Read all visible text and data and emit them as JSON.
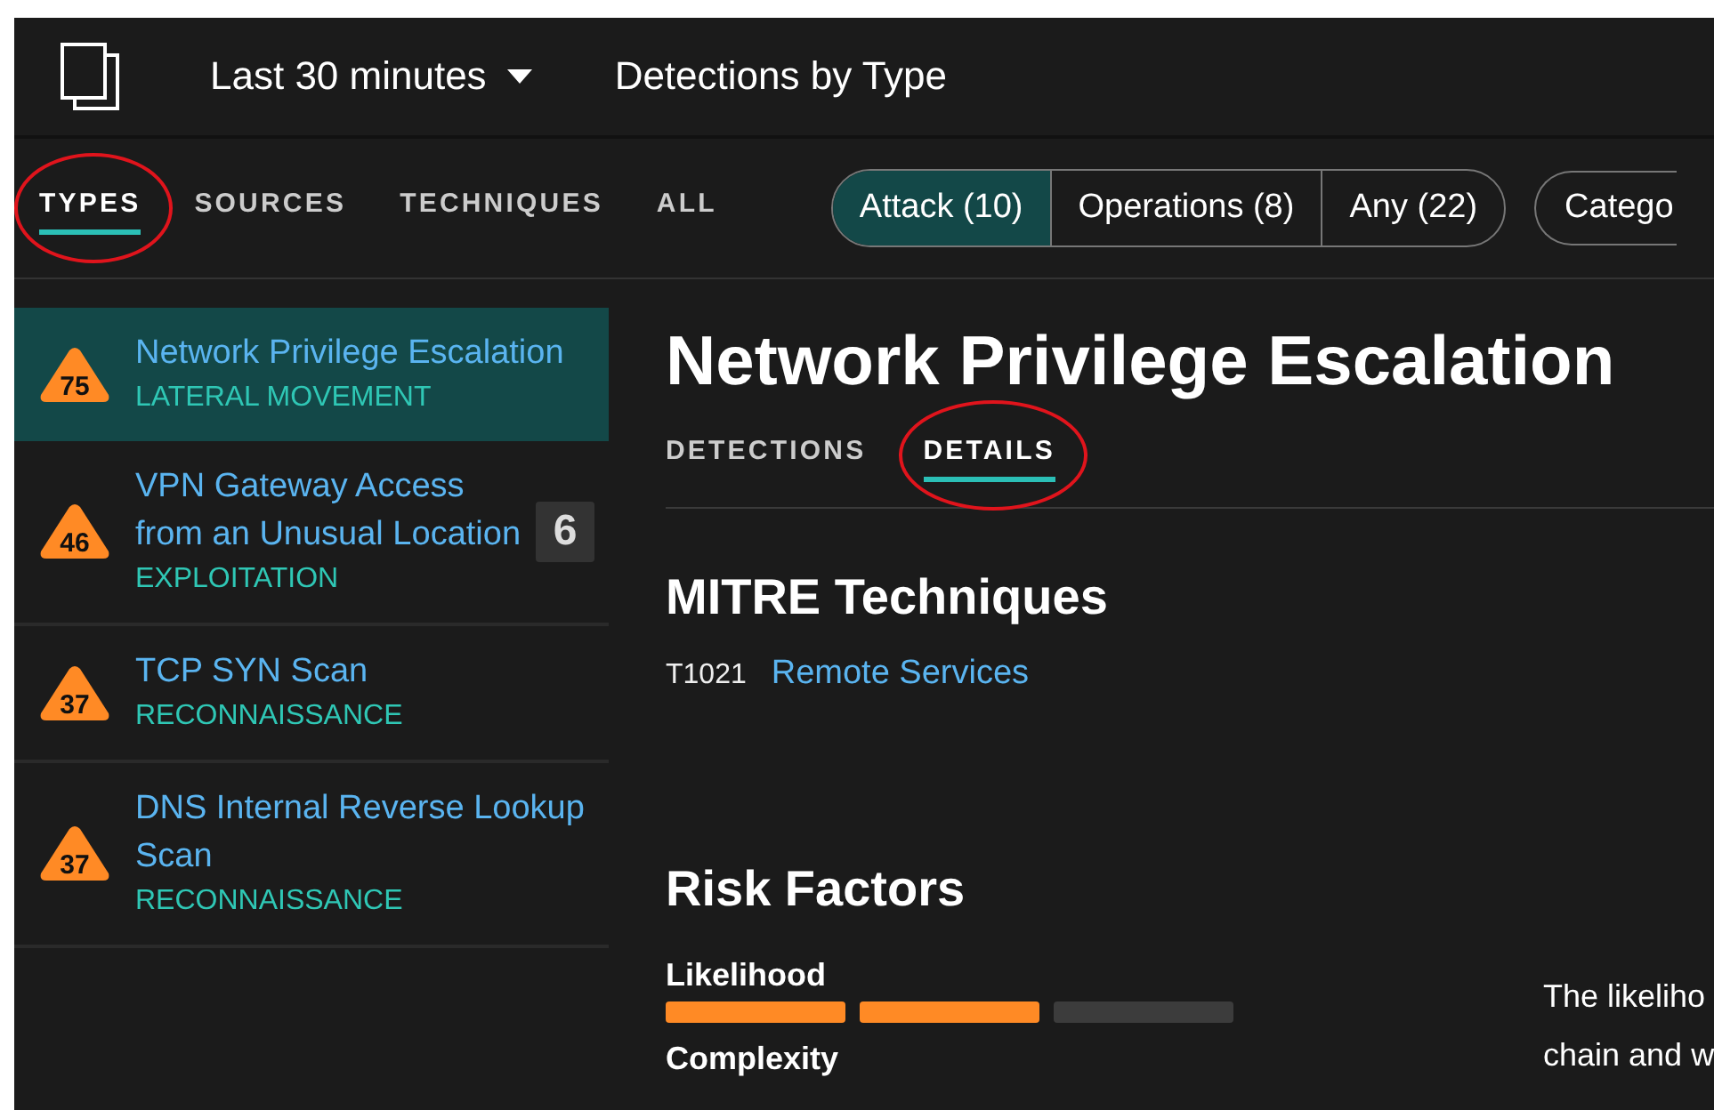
{
  "top_bar": {
    "time_range": "Last 30 minutes",
    "title": "Detections by Type"
  },
  "view_tabs": [
    {
      "label": "TYPES",
      "selected": true,
      "circled": true
    },
    {
      "label": "SOURCES",
      "selected": false,
      "circled": false
    },
    {
      "label": "TECHNIQUES",
      "selected": false,
      "circled": false
    },
    {
      "label": "ALL",
      "selected": false,
      "circled": false
    }
  ],
  "filter_segments": [
    {
      "label": "Attack (10)",
      "selected": true
    },
    {
      "label": "Operations (8)",
      "selected": false
    },
    {
      "label": "Any (22)",
      "selected": false
    }
  ],
  "category_button": "Catego",
  "sidebar": {
    "items": [
      {
        "score": "75",
        "title": "Network Privilege Escalation",
        "category": "LATERAL MOVEMENT",
        "selected": true
      },
      {
        "score": "46",
        "title": "VPN Gateway Access from an Unusual Location",
        "category": "EXPLOITATION",
        "selected": false,
        "count": "6"
      },
      {
        "score": "37",
        "title": "TCP SYN Scan",
        "category": "RECONNAISSANCE",
        "selected": false
      },
      {
        "score": "37",
        "title": "DNS Internal Reverse Lookup Scan",
        "category": "RECONNAISSANCE",
        "selected": false
      }
    ]
  },
  "detail": {
    "title": "Network Privilege Escalation",
    "tabs": [
      {
        "label": "DETECTIONS",
        "selected": false,
        "circled": false
      },
      {
        "label": "DETAILS",
        "selected": true,
        "circled": true
      }
    ],
    "mitre_heading": "MITRE Techniques",
    "techniques": [
      {
        "id": "T1021",
        "name": "Remote Services"
      }
    ],
    "risk_heading": "Risk Factors",
    "risk_factors": [
      {
        "name": "Likelihood",
        "level": 0.67
      },
      {
        "name": "Complexity"
      }
    ],
    "description_lines": [
      "The likeliho",
      "chain and w"
    ]
  }
}
